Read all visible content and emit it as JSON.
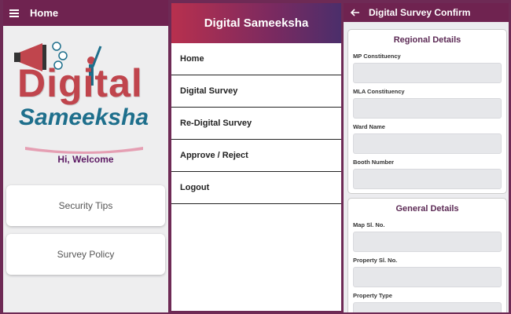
{
  "home": {
    "title": "Home",
    "logo_word1": "Digital",
    "logo_word2": "Sameeksha",
    "welcome": "Hi, Welcome",
    "cards": [
      "Security Tips",
      "Survey Policy"
    ]
  },
  "drawer": {
    "title": "Digital Sameeksha",
    "items": [
      "Home",
      "Digital Survey",
      "Re-Digital Survey",
      "Approve / Reject",
      "Logout"
    ]
  },
  "confirm": {
    "title": "Digital Survey Confirm",
    "sections": [
      {
        "title": "Regional Details",
        "fields": [
          "MP Constituency",
          "MLA Constituency",
          "Ward Name",
          "Booth Number"
        ]
      },
      {
        "title": "General Details",
        "fields": [
          "Map Sl. No.",
          "Property Sl. No.",
          "Property Type"
        ]
      }
    ]
  },
  "colors": {
    "frame": "#6e2a55",
    "appbar": "#6f2350",
    "logo_red": "#c0454d",
    "logo_blue": "#1e6f8c",
    "welcome": "#5c1a63"
  },
  "icons": {
    "menu": "hamburger-icon",
    "back": "arrow-left-icon",
    "logo": "megaphone-person-icon"
  }
}
